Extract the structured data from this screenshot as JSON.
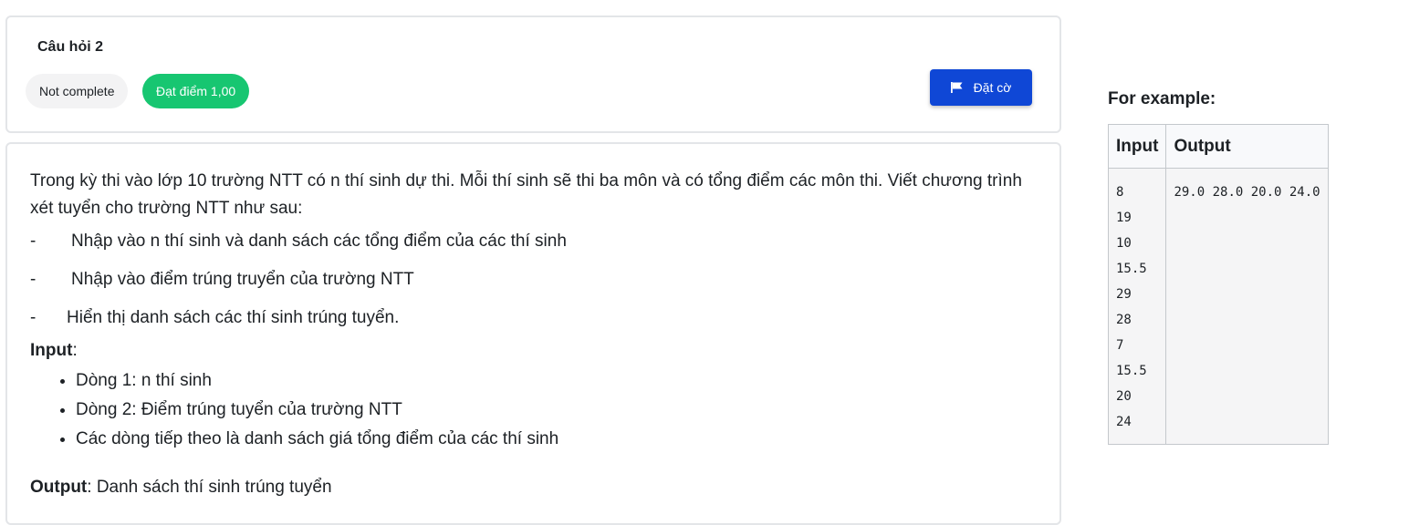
{
  "question": {
    "title": "Câu hỏi 2",
    "state": "Not complete",
    "grade": "Đạt điểm 1,00",
    "flag_label": "Đặt cờ",
    "icons": {
      "flag": "flag-icon"
    },
    "colors": {
      "grade_badge": "#17c671",
      "flag_button": "#0f47d6"
    }
  },
  "content": {
    "intro": "Trong kỳ thi vào lớp 10 trường NTT có n thí sinh dự thi. Mỗi thí sinh sẽ thi ba môn và có tổng điểm các môn thi. Viết chương trình xét tuyển cho trường NTT như sau:",
    "dash_items": [
      {
        "dash": "-",
        "text": "Nhập vào n thí sinh và danh sách các tổng điểm của các thí sinh"
      },
      {
        "dash": "-",
        "text": "Nhập vào điểm trúng truyển của trường NTT"
      },
      {
        "dash": "-",
        "text": "Hiển thị danh sách các thí sinh trúng tuyển."
      }
    ],
    "input_heading": "Input",
    "input_items": [
      "Dòng 1: n thí sinh",
      "Dòng 2: Điểm trúng tuyển của trường NTT",
      "Các dòng tiếp theo là danh sách giá tổng điểm của các thí sinh"
    ],
    "output_heading": "Output",
    "output_text": ": Danh sách thí sinh trúng tuyển"
  },
  "example": {
    "title": "For example:",
    "columns": [
      "Input",
      "Output"
    ],
    "input": "8\n19\n10\n15.5\n29\n28\n7\n15.5\n20\n24",
    "output": "29.0 28.0 20.0 24.0"
  }
}
